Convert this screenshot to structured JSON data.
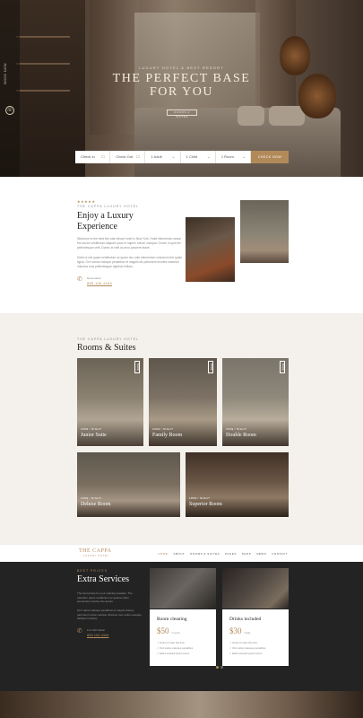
{
  "hero": {
    "sidebar_text": "BOOK NOW",
    "eyebrow": "LUXURY HOTEL & BEST RESORT",
    "title_line1": "THE PERFECT BASE",
    "title_line2": "FOR YOU",
    "cta": "ROOMS & SUITES",
    "booking": {
      "check_in": "Check In",
      "check_out": "Check Out",
      "adult": "1 Adult",
      "child": "1 Child",
      "room": "1 Room",
      "button": "CHECK NOW"
    }
  },
  "about": {
    "stars": "★★★★★",
    "eyebrow": "THE CAPPA LUXURY HOTEL",
    "title": "Enjoy a Luxury Experience",
    "p1": "Welcome to the best five-star deluxe hotel in New York. Hotel elementum sesue the auctor vestibulum aliquam justo in sapien rutrum volutpat. Donec in quis the pellentesque velit. Donec id velit ac arcu posuere blane.",
    "p2": "Hotel ut nisl quam nestibulum ac quam nec odio elementum ceisutrum the quam ligula. Orci varius natoque penatibus et magnis dis parturient montes nascetur ridiculus mus pellentesque dapibus finibus.",
    "reservation_label": "Reservation",
    "reservation_number": "855 100 4444"
  },
  "rooms": {
    "eyebrow": "THE CAPPA LUXURY HOTEL",
    "title": "Rooms & Suites",
    "items": [
      {
        "size": "150$ / NIGHT",
        "name": "Junior Suite",
        "badge": "BOOK"
      },
      {
        "size": "200$ / NIGHT",
        "name": "Family Room",
        "badge": "BOOK"
      },
      {
        "size": "250$ / NIGHT",
        "name": "Double Room",
        "badge": "BOOK"
      },
      {
        "size": "150$ / NIGHT",
        "name": "Deluxe Room",
        "badge": ""
      },
      {
        "size": "180$ / NIGHT",
        "name": "Superior Room",
        "badge": ""
      }
    ]
  },
  "nav": {
    "logo": "THE CAPPA",
    "logo_sub": "LUXURY HOTEL",
    "items": [
      "HOME",
      "ABOUT",
      "ROOMS & SUITES",
      "PAGES",
      "SHOP",
      "NEWS",
      "CONTACT"
    ]
  },
  "services": {
    "eyebrow": "BEST PRICES",
    "title": "Extra Services",
    "p1": "The best prices for your relaxing vacation. The utanislen quam nestibulum ac quame odion elementum sceisue the aucan.",
    "p2": "Orci varius natoque penatibus et magnis disney parturient monte nascete ridiculus mus nellen etesque habitant morbine.",
    "reservation_label": "For information",
    "reservation_number": "855 100 4444",
    "cards": [
      {
        "title": "Room cleaning",
        "price": "$50",
        "unit": "/ month",
        "features": [
          "Hotel ut nisan the duis",
          "Orci varius natoque penatibus",
          "Etiam suscipit ipsum lorem"
        ]
      },
      {
        "title": "Drinks included",
        "price": "$30",
        "unit": "/ daily",
        "features": [
          "Hotel ut nisan the duis",
          "Orci varius natoque penatibus",
          "Etiam suscipit ipsum lorem"
        ]
      }
    ]
  }
}
